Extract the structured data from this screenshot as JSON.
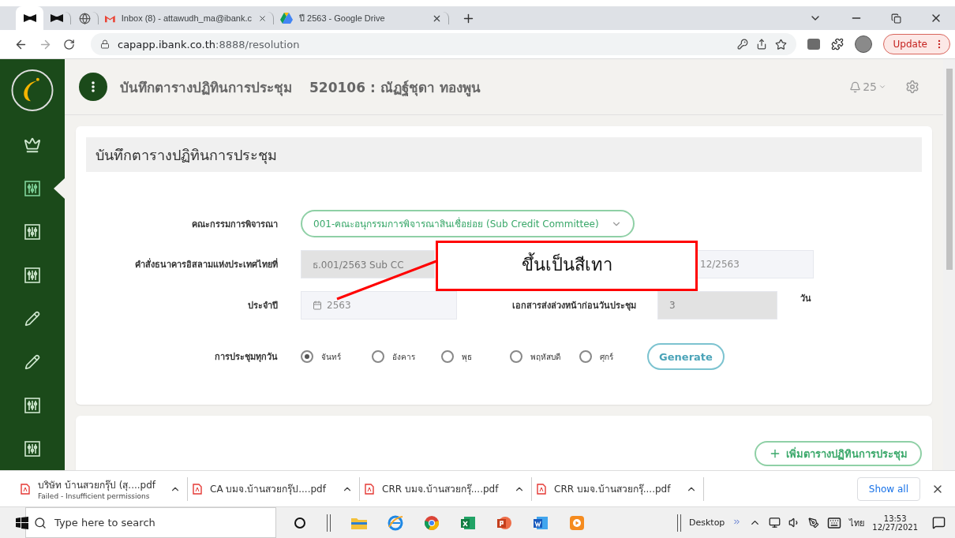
{
  "browser": {
    "tabs": [
      {
        "kind": "bowtie",
        "selected": true
      },
      {
        "kind": "bowtie",
        "selected": false
      },
      {
        "kind": "globe",
        "selected": false
      },
      {
        "kind": "mail",
        "title": "Inbox (8) - attawudh_ma@ibank.c",
        "selected": false
      },
      {
        "kind": "drive",
        "title": "ปี 2563 - Google Drive",
        "selected": false
      }
    ],
    "address": {
      "host": "capapp.ibank.co.th",
      "path": ":8888/resolution"
    },
    "update": "Update"
  },
  "sidebar": [
    {
      "kind": "crown",
      "selected": false
    },
    {
      "kind": "mixer",
      "selected": true
    },
    {
      "kind": "mixer",
      "selected": false
    },
    {
      "kind": "mixer",
      "selected": false
    },
    {
      "kind": "pencil",
      "selected": false
    },
    {
      "kind": "pencil",
      "selected": false
    },
    {
      "kind": "mixer",
      "selected": false
    },
    {
      "kind": "mixer",
      "selected": false
    }
  ],
  "header": {
    "title": "บันทึกตารางปฏิทินการประชุม",
    "record": "520106 : ณัฏฐ์ชุดา ทองพูน",
    "notifications": "25"
  },
  "card": {
    "title": "บันทึกตารางปฏิทินการประชุม",
    "committee": {
      "label": "คณะกรรมการพิจารณา",
      "value": "001-คณะอนุกรรมการพิจารณาสินเชื่อย่อย (Sub Credit Committee)"
    },
    "order": {
      "label": "คำสั่งธนาคารอิสลามแห่งประเทศไทยที่",
      "fields": [
        {
          "value": "ธ.001/2563 Sub CC",
          "disabled": true
        },
        {
          "value": "12/2563",
          "disabled": false
        }
      ]
    },
    "year": {
      "label": "ประจำปี",
      "value": "2563",
      "disabled": false
    },
    "advance": {
      "label": "เอกสารส่งล่วงหน้าก่อนวันประชุม",
      "value": "3",
      "disabled": true,
      "unit": "วัน"
    },
    "meeting_day": {
      "label": "การประชุมทุกวัน",
      "options": [
        {
          "label": "จันทร์",
          "selected": true
        },
        {
          "label": "อังคาร",
          "selected": false
        },
        {
          "label": "พุธ",
          "selected": false
        },
        {
          "label": "พฤหัสบดี",
          "selected": false
        },
        {
          "label": "ศุกร์",
          "selected": false
        }
      ]
    },
    "generate": "Generate"
  },
  "add_button": "เพิ่มตารางปฏิทินการประชุม",
  "annotation": {
    "text": "ขึ้นเป็นสีเทา"
  },
  "downloads": {
    "items": [
      {
        "name": "บริษัท บ้านสวยกรุ๊ป (สุ....pdf",
        "status": "Failed - Insufficient permissions"
      },
      {
        "name": "CA บมจ.บ้านสวยกรุ๊ป....pdf"
      },
      {
        "name": "CRR บมจ.บ้านสวยกรุ๊....pdf"
      },
      {
        "name": "CRR บมจ.บ้านสวยกรุ๊....pdf"
      }
    ],
    "show_all": "Show all"
  },
  "taskbar": {
    "search": {
      "placeholder": "Type here to search"
    },
    "desktop": "Desktop",
    "language": "ไทย",
    "time": "13:53",
    "date": "12/27/2021"
  }
}
